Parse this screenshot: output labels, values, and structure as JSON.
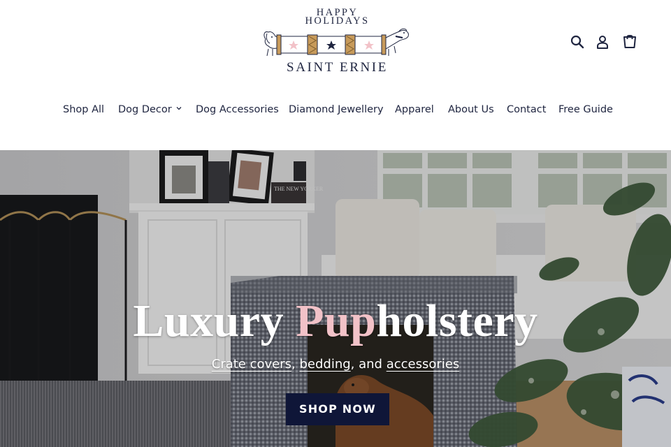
{
  "logo": {
    "line1": "HAPPY",
    "line2": "HOLIDAYS",
    "brand": "SAINT ERNIE"
  },
  "header_icons": [
    "search-icon",
    "account-icon",
    "cart-icon"
  ],
  "nav": {
    "items": [
      {
        "label": "Shop All"
      },
      {
        "label": "Dog Decor",
        "has_dropdown": true
      },
      {
        "label": "Dog Accessories"
      },
      {
        "label": "Diamond Jewellery"
      },
      {
        "label": "Apparel"
      },
      {
        "label": "About Us"
      },
      {
        "label": "Contact"
      },
      {
        "label": "Free Guide"
      }
    ]
  },
  "hero": {
    "title_part1": "Luxury ",
    "title_highlight": "Pup",
    "title_part2": "holstery",
    "subtitle_parts": [
      "Crate covers",
      ", ",
      "bedding",
      ", and ",
      "accessories"
    ],
    "cta_label": "SHOP NOW",
    "frame_text": "THE NEW YORKER"
  },
  "colors": {
    "brand_navy": "#0f1638",
    "text_navy": "#1f2540",
    "highlight_pink": "#f2c2c8",
    "background": "#ffffff"
  }
}
